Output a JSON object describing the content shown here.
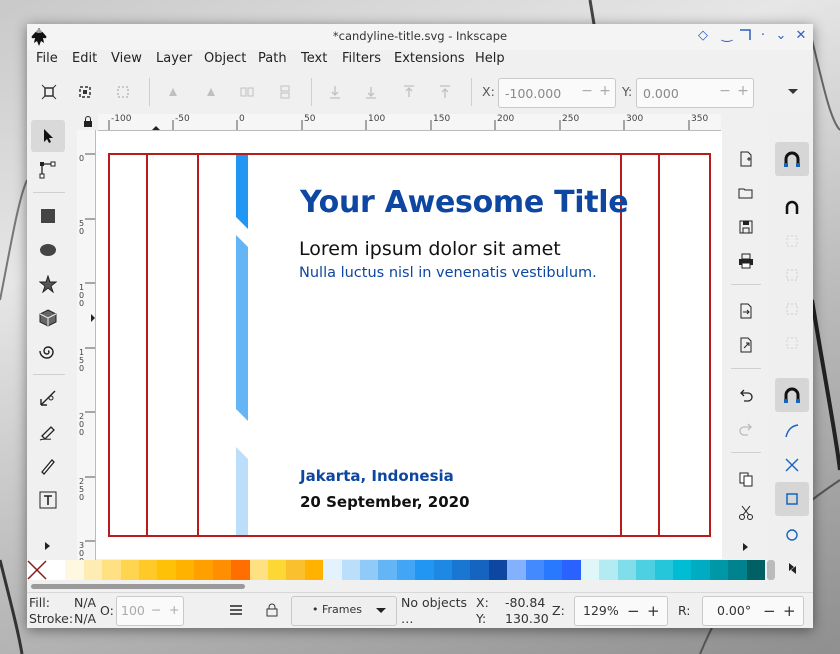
{
  "window": {
    "title": "*candyline-title.svg - Inkscape",
    "controls": [
      "diamond-icon",
      "minimize-icon",
      "maximize-icon",
      "dot-icon",
      "close-icon"
    ]
  },
  "menu": [
    "File",
    "Edit",
    "View",
    "Layer",
    "Object",
    "Path",
    "Text",
    "Filters",
    "Extensions",
    "Help"
  ],
  "toolbar": {
    "x_label": "X:",
    "x_value": "-100.000",
    "y_label": "Y:",
    "y_value": "0.000",
    "minus": "−",
    "plus": "+"
  },
  "ruler": {
    "h_labels": [
      "-100",
      "-50",
      "0",
      "50",
      "100",
      "150",
      "200",
      "250",
      "300",
      "350"
    ],
    "v_labels": [
      "0",
      "50",
      "100",
      "150",
      "200",
      "250",
      "300"
    ]
  },
  "document": {
    "title": "Your Awesome Title",
    "subtitle": "Lorem ipsum dolor sit amet",
    "tagline": "Nulla luctus nisl in venenatis vestibulum.",
    "location": "Jakarta, Indonesia",
    "date": "20 September, 2020",
    "colors": {
      "title": "#0d47a1",
      "guide": "#b71c1c",
      "stripe_dark": "#2196f3",
      "stripe_mid": "#64b5f6",
      "stripe_light": "#bbdefb"
    }
  },
  "palette": [
    "#ffffff",
    "#fff8e1",
    "#ffecb3",
    "#ffe082",
    "#ffd54f",
    "#ffca28",
    "#ffc107",
    "#ffb300",
    "#ffa000",
    "#ff8f00",
    "#ff6f00",
    "#ffe082",
    "#fdd835",
    "#fbc02d",
    "#ffb300",
    "#e3f2fd",
    "#bbdefb",
    "#90caf9",
    "#64b5f6",
    "#42a5f5",
    "#2196f3",
    "#1e88e5",
    "#1976d2",
    "#1565c0",
    "#0d47a1",
    "#82b1ff",
    "#448aff",
    "#2979ff",
    "#2962ff",
    "#e0f7fa",
    "#b2ebf2",
    "#80deea",
    "#4dd0e1",
    "#26c6da",
    "#00bcd4",
    "#00acc1",
    "#0097a7",
    "#00838f",
    "#006064"
  ],
  "status": {
    "fill_label": "Fill:",
    "fill_value": "N/A",
    "stroke_label": "Stroke:",
    "stroke_value": "N/A",
    "opacity_label": "O:",
    "opacity_value": "100",
    "layer_value": "• Frames",
    "message": "No objects …",
    "x_label": "X:",
    "x_value": "-80.84",
    "y_label": "Y:",
    "y_value": "130.30",
    "zoom_label": "Z:",
    "zoom_value": "129%",
    "rotate_label": "R:",
    "rotate_value": "0.00°"
  }
}
